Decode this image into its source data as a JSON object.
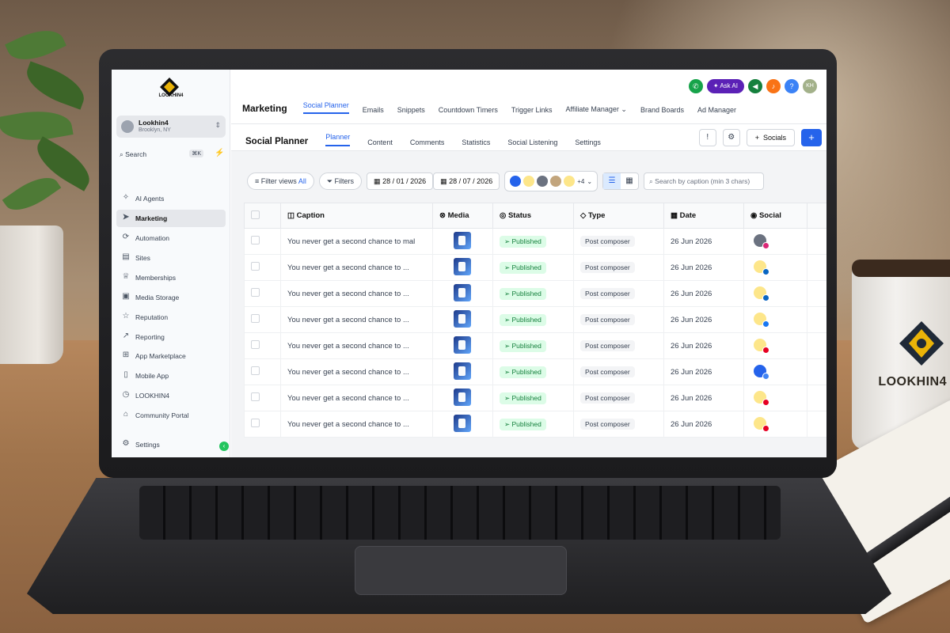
{
  "sidebar": {
    "logo_text": "LOOKHIN4",
    "account": {
      "name": "Lookhin4",
      "location": "Brooklyn, NY"
    },
    "search": {
      "label": "Search",
      "shortcut": "⌘K"
    },
    "items": [
      {
        "label": "AI Agents",
        "icon": "sparkle-icon"
      },
      {
        "label": "Marketing",
        "icon": "send-icon",
        "active": true
      },
      {
        "label": "Automation",
        "icon": "automation-icon"
      },
      {
        "label": "Sites",
        "icon": "sites-icon"
      },
      {
        "label": "Memberships",
        "icon": "membership-icon"
      },
      {
        "label": "Media Storage",
        "icon": "image-icon"
      },
      {
        "label": "Reputation",
        "icon": "star-icon"
      },
      {
        "label": "Reporting",
        "icon": "chart-icon"
      },
      {
        "label": "App Marketplace",
        "icon": "grid-icon"
      },
      {
        "label": "Mobile App",
        "icon": "phone-icon"
      },
      {
        "label": "LOOKHIN4",
        "icon": "clock-icon"
      },
      {
        "label": "Community Portal",
        "icon": "building-icon"
      }
    ],
    "settings": "Settings"
  },
  "topbar": {
    "ask_ai": "Ask AI",
    "avatar_initials": "KH"
  },
  "nav1": {
    "title": "Marketing",
    "tabs": [
      "Social Planner",
      "Emails",
      "Snippets",
      "Countdown Timers",
      "Trigger Links",
      "Affiliate Manager",
      "Brand Boards",
      "Ad Manager"
    ]
  },
  "nav2": {
    "title": "Social Planner",
    "tabs": [
      "Planner",
      "Content",
      "Comments",
      "Statistics",
      "Social Listening",
      "Settings"
    ],
    "socials_button": "Socials"
  },
  "filters": {
    "filter_views": "Filter views",
    "filter_views_value": "All",
    "filters": "Filters",
    "date_from": "28 / 01 / 2026",
    "date_to": "28 / 07 / 2026",
    "more_accounts": "+4",
    "search_placeholder": "Search by caption (min 3 chars)"
  },
  "table": {
    "headers": [
      "Caption",
      "Media",
      "Status",
      "Type",
      "Date",
      "Social"
    ],
    "rows": [
      {
        "caption": "You never get a second chance to mal",
        "status": "Published",
        "type": "Post composer",
        "date": "26 Jun 2026",
        "network": "instagram"
      },
      {
        "caption": "You never get a second chance to ...",
        "status": "Published",
        "type": "Post composer",
        "date": "26 Jun 2026",
        "network": "linkedin"
      },
      {
        "caption": "You never get a second chance to ...",
        "status": "Published",
        "type": "Post composer",
        "date": "26 Jun 2026",
        "network": "linkedin"
      },
      {
        "caption": "You never get a second chance to ...",
        "status": "Published",
        "type": "Post composer",
        "date": "26 Jun 2026",
        "network": "facebook"
      },
      {
        "caption": "You never get a second chance to ...",
        "status": "Published",
        "type": "Post composer",
        "date": "26 Jun 2026",
        "network": "pinterest"
      },
      {
        "caption": "You never get a second chance to ...",
        "status": "Published",
        "type": "Post composer",
        "date": "26 Jun 2026",
        "network": "google"
      },
      {
        "caption": "You never get a second chance to ...",
        "status": "Published",
        "type": "Post composer",
        "date": "26 Jun 2026",
        "network": "pinterest"
      },
      {
        "caption": "You never get a second chance to ...",
        "status": "Published",
        "type": "Post composer",
        "date": "26 Jun 2026",
        "network": "pinterest"
      }
    ]
  },
  "mug": {
    "brand_text": "LOOKHIN4"
  },
  "colors": {
    "accent": "#2563eb",
    "published": "#15803d",
    "sidebar_active": "#e5e7eb",
    "ask_ai": "#5b21b6"
  }
}
